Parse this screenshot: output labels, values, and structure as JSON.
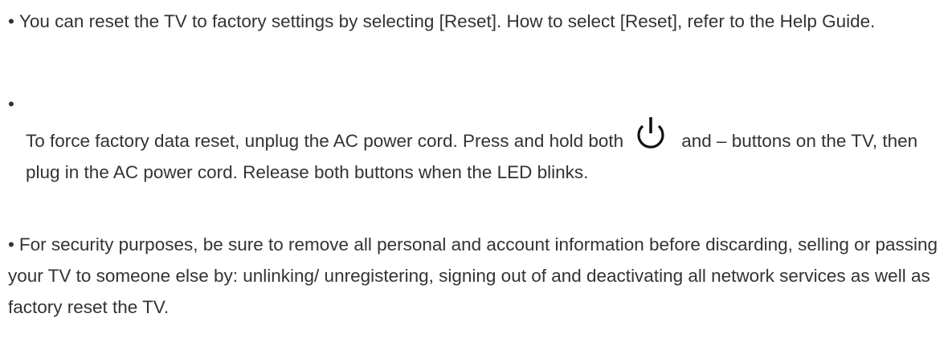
{
  "bullets": [
    {
      "text": "You can reset the TV to factory settings by selecting [Reset]. How to select [Reset], refer to the Help Guide."
    },
    {
      "text_before_icon": "To force factory data reset, unplug the AC power cord. Press and hold both",
      "icon": "power-icon",
      "text_after_icon": "and – buttons on the TV, then plug in the AC power cord. Release both buttons when the LED blinks."
    },
    {
      "text": "For security purposes, be sure to remove all personal and account information before discarding, selling or passing your TV to someone else by: unlinking/ unregistering, signing out of and deactivating all network services as well as factory reset the TV."
    }
  ],
  "bullet_symbol": "•",
  "text_color": "#333333"
}
